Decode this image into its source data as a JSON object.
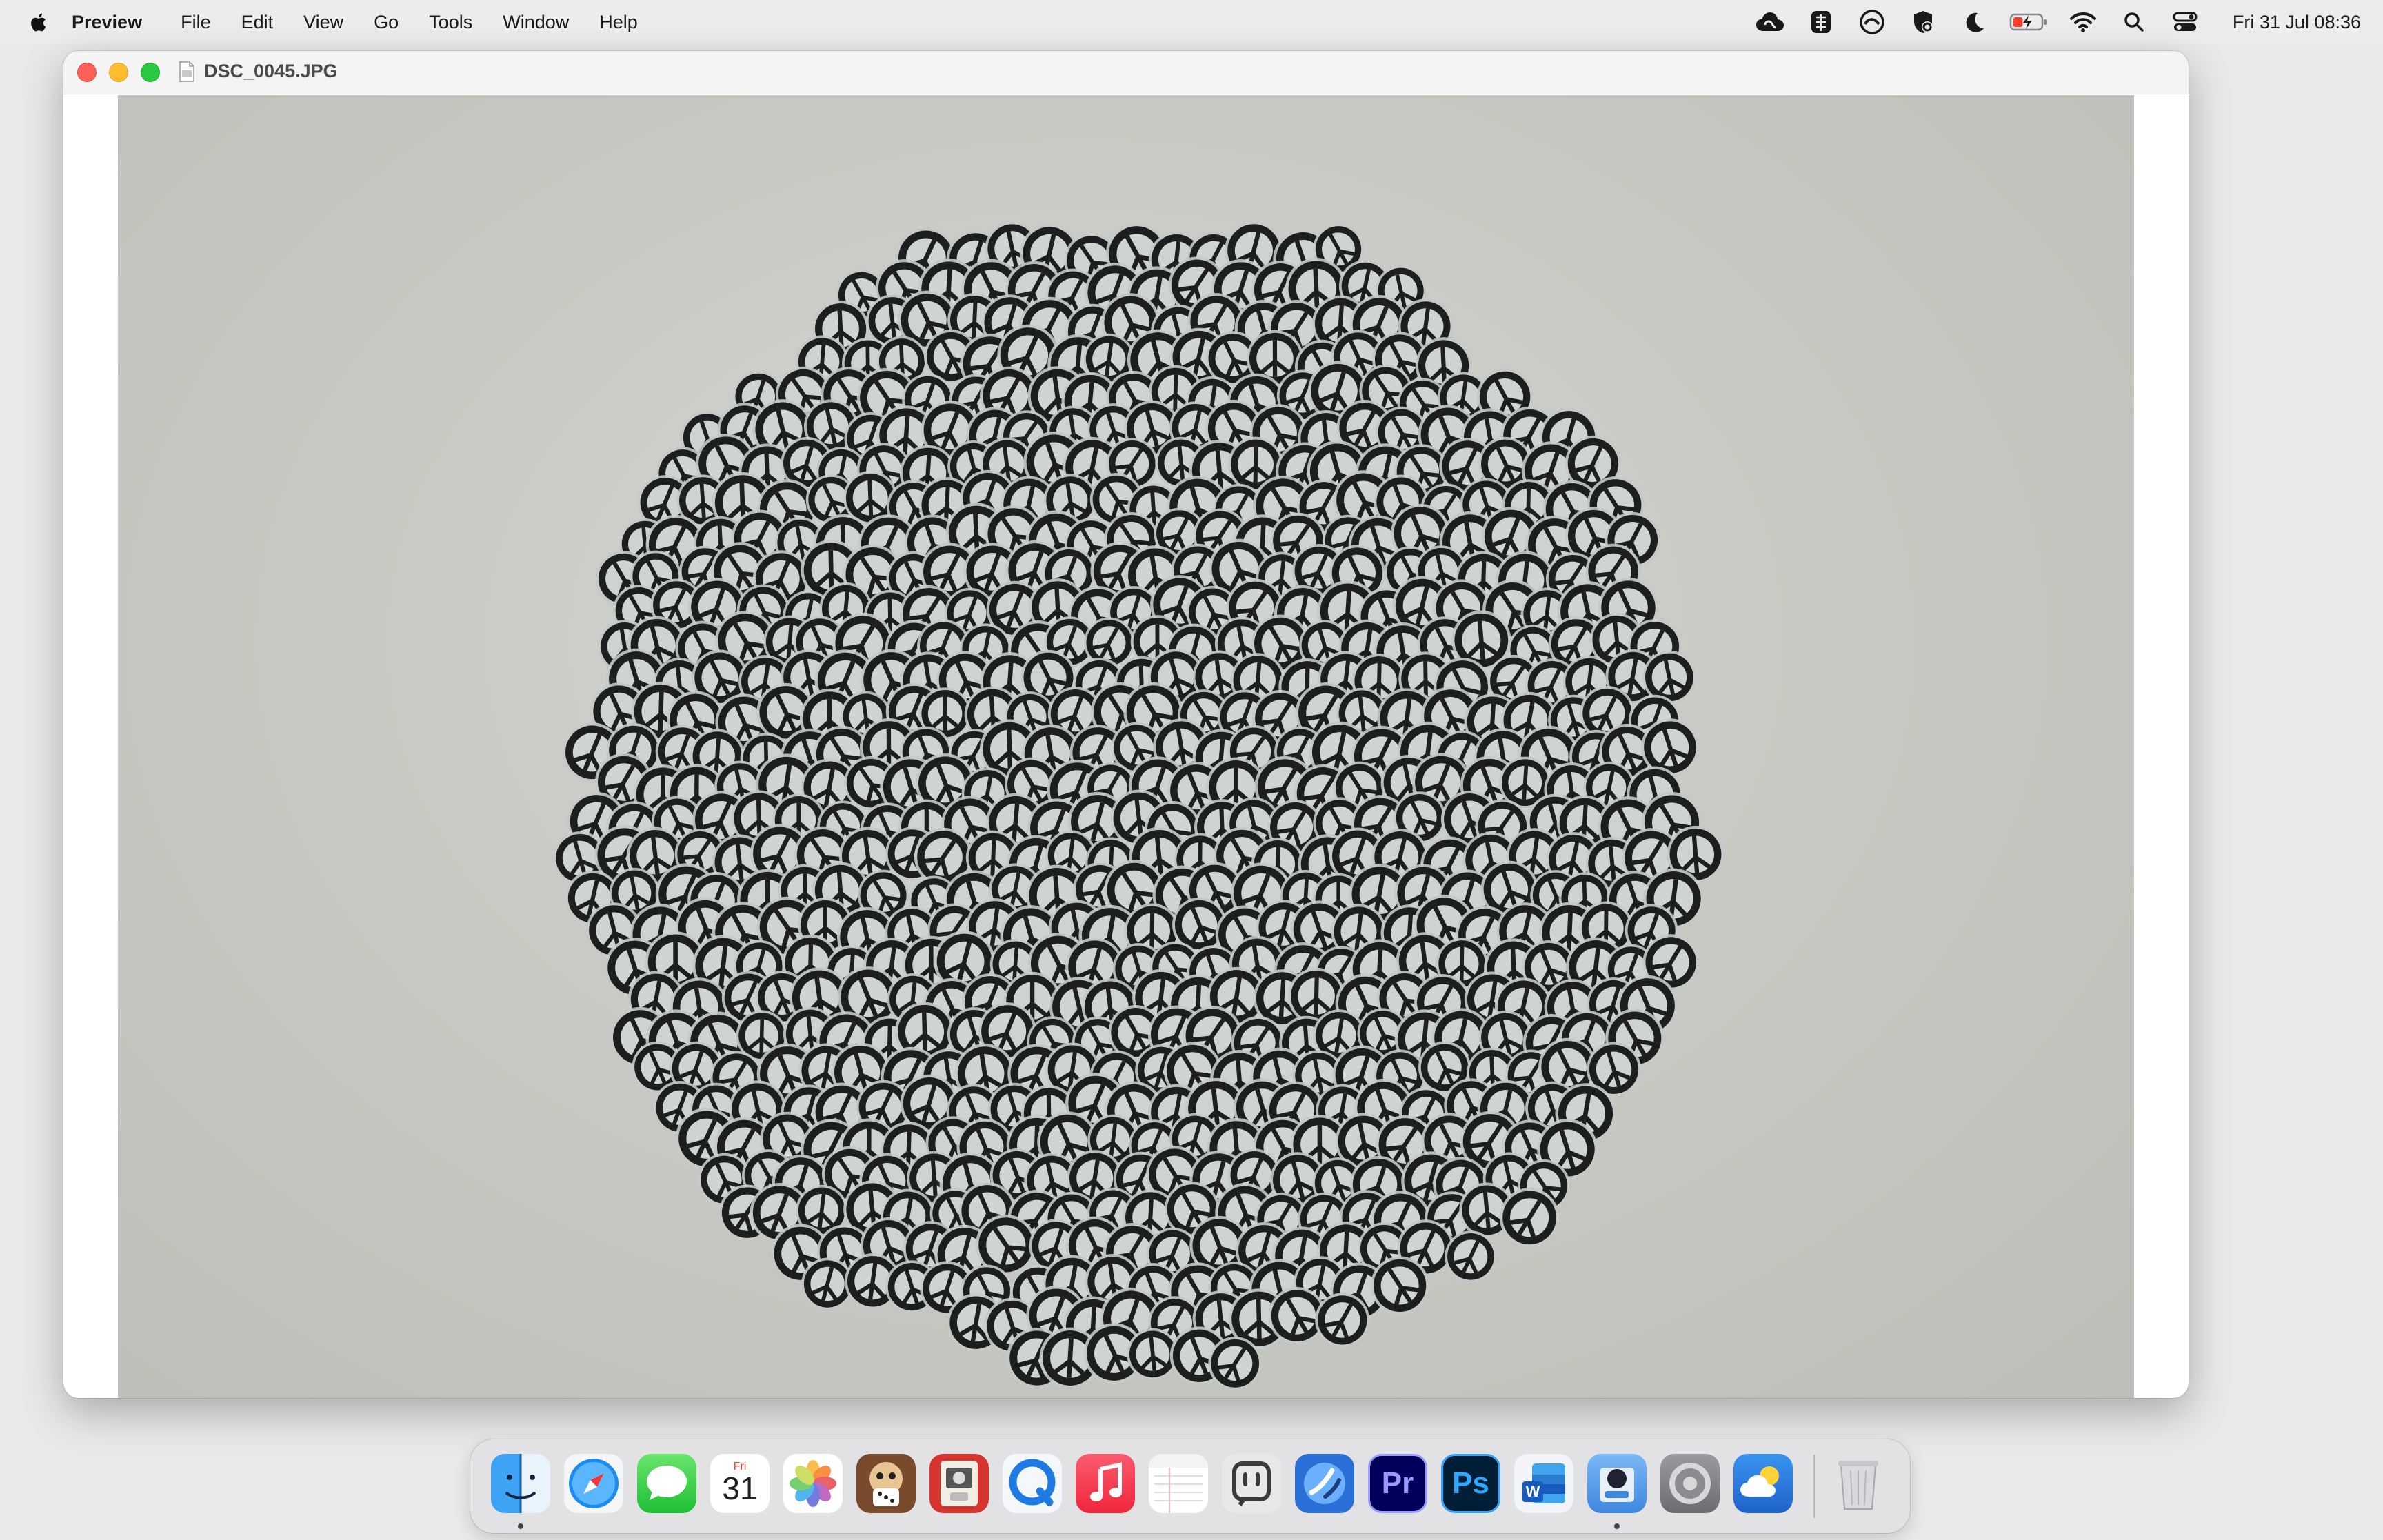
{
  "menubar": {
    "apple_icon": "apple-logo-icon",
    "app_name": "Preview",
    "menus": [
      "File",
      "Edit",
      "View",
      "Go",
      "Tools",
      "Window",
      "Help"
    ],
    "status_icons": [
      "creative-cloud-icon",
      "cell-tower-extension-icon",
      "cc-sync-icon",
      "shield-gear-icon",
      "moon-focus-icon",
      "battery-charging-icon",
      "wifi-icon",
      "spotlight-search-icon",
      "control-center-icon"
    ],
    "clock": "Fri 31 Jul  08:36",
    "battery_level": 0.35
  },
  "window": {
    "title": "DSC_0045.JPG",
    "doc_icon": "jpeg-document-icon",
    "image_subject": "peace-sign-stickers-cluster"
  },
  "dock": {
    "apps": [
      {
        "name": "Finder",
        "icon": "finder-icon",
        "running": true
      },
      {
        "name": "Safari",
        "icon": "safari-icon",
        "running": false
      },
      {
        "name": "Messages",
        "icon": "messages-icon",
        "running": false
      },
      {
        "name": "Calendar",
        "icon": "calendar-icon",
        "running": false,
        "day_label": "Fri",
        "day_number": "31"
      },
      {
        "name": "Photos",
        "icon": "photos-icon",
        "running": false
      },
      {
        "name": "Dice app",
        "icon": "dice-app-icon",
        "running": false
      },
      {
        "name": "Photo Booth",
        "icon": "photo-booth-icon",
        "running": false
      },
      {
        "name": "QuickTime",
        "icon": "quicktime-icon",
        "running": false
      },
      {
        "name": "Music",
        "icon": "music-icon",
        "running": false
      },
      {
        "name": "Notes",
        "icon": "notes-icon",
        "running": false
      },
      {
        "name": "Mastodon",
        "icon": "mastodon-icon",
        "running": false
      },
      {
        "name": "Migration app",
        "icon": "migration-icon",
        "running": false
      },
      {
        "name": "Premiere Pro",
        "icon": "premiere-pro-icon",
        "label": "Pr",
        "running": false
      },
      {
        "name": "Photoshop",
        "icon": "photoshop-icon",
        "label": "Ps",
        "running": false
      },
      {
        "name": "Word",
        "icon": "word-icon",
        "label": "W",
        "running": false
      },
      {
        "name": "Preview",
        "icon": "preview-icon",
        "running": true
      },
      {
        "name": "System Settings",
        "icon": "system-settings-icon",
        "running": false
      },
      {
        "name": "Weather",
        "icon": "weather-icon",
        "running": false
      }
    ],
    "trash_icon": "trash-icon"
  },
  "colors": {
    "menubar_bg": "#ececee",
    "close": "#fe5f57",
    "minimize": "#febc2e",
    "maximize": "#28c840",
    "sticker_dark": "#1c1f1e",
    "sticker_light": "#cfd3d3",
    "photo_bg": "#c8cac3"
  }
}
